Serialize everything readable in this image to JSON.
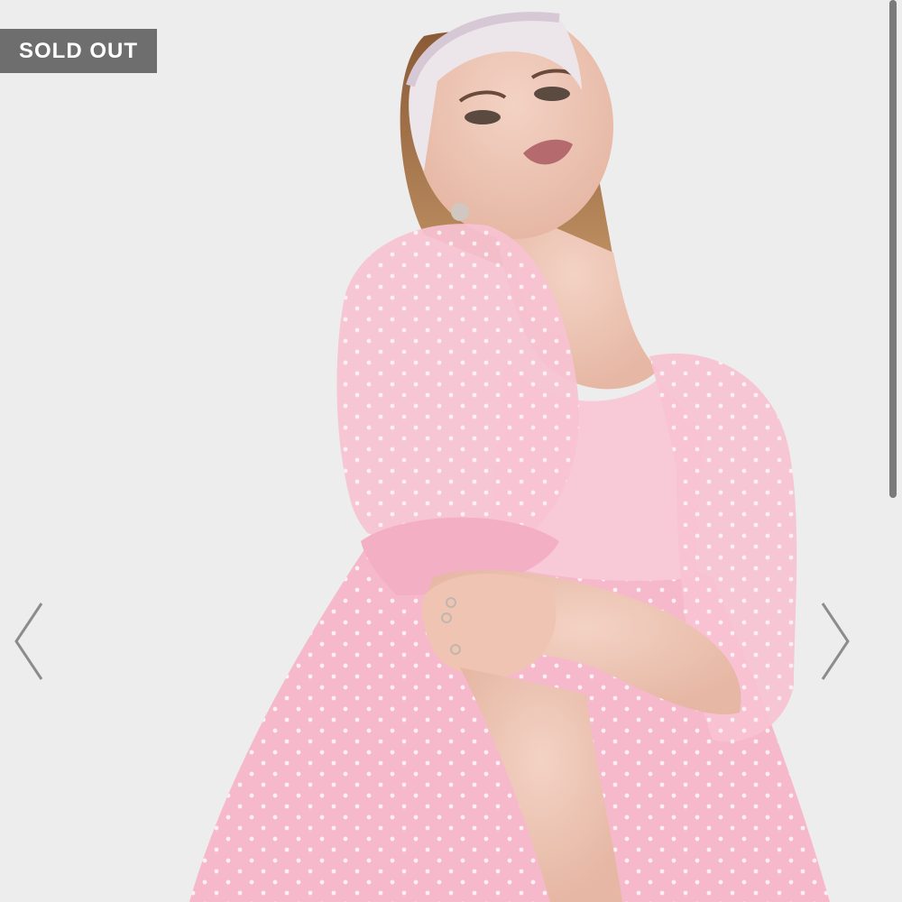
{
  "badge": {
    "label": "SOLD OUT",
    "background": "#6e6e6e",
    "text_color": "#ffffff"
  },
  "gallery": {
    "background": "#ededed",
    "prev_icon": "chevron-left-icon",
    "next_icon": "chevron-right-icon",
    "arrow_color": "#8c8c8c"
  },
  "product": {
    "dress_color": "#f6b9cc",
    "dot_color": "#ffffff"
  }
}
